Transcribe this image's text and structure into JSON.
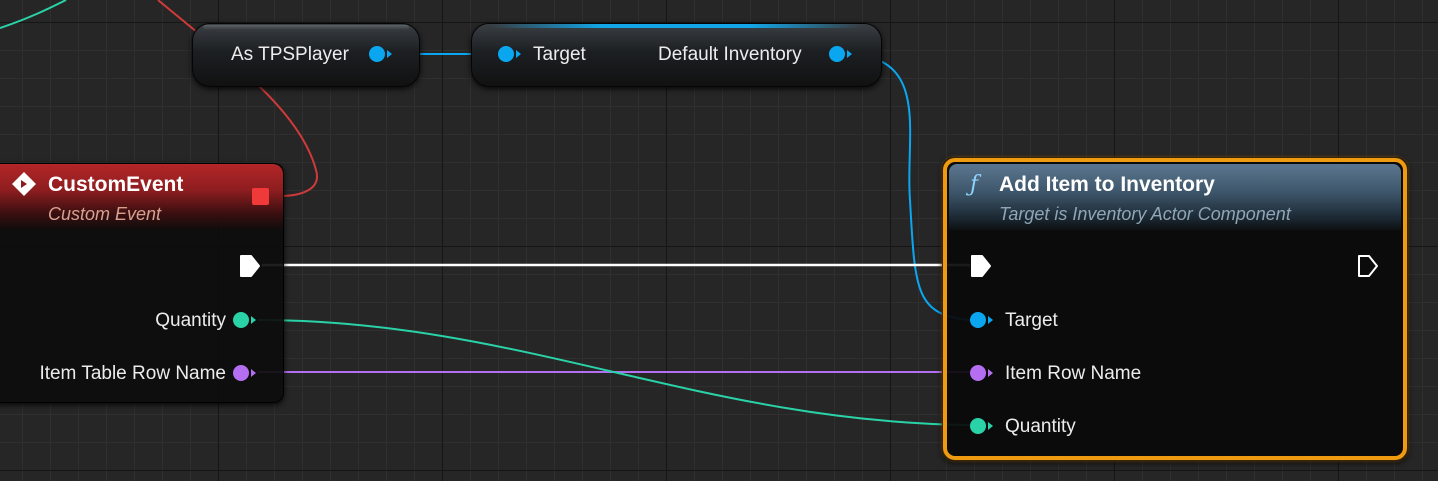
{
  "colors": {
    "exec_wire": "#ffffff",
    "object_wire": "#0aa7f0",
    "int_wire": "#2ad2a8",
    "name_wire": "#b46ef2",
    "event_header": "#b32628",
    "function_header": "#4a6478",
    "selection": "#ef9b12"
  },
  "cast_node": {
    "output_label": "As TPSPlayer"
  },
  "get_node": {
    "input_label": "Target",
    "output_label": "Default Inventory"
  },
  "event_node": {
    "icon": "event-diamond-icon",
    "title": "CustomEvent",
    "subtitle": "Custom Event",
    "pins": [
      {
        "label": "Quantity",
        "type": "int"
      },
      {
        "label": "Item Table Row Name",
        "type": "name"
      }
    ]
  },
  "function_node": {
    "icon": "function-icon",
    "icon_glyph": "ƒ",
    "title": "Add Item to Inventory",
    "subtitle": "Target is Inventory Actor Component",
    "pins": [
      {
        "label": "Target",
        "type": "object"
      },
      {
        "label": "Item Row Name",
        "type": "name"
      },
      {
        "label": "Quantity",
        "type": "int"
      }
    ]
  }
}
